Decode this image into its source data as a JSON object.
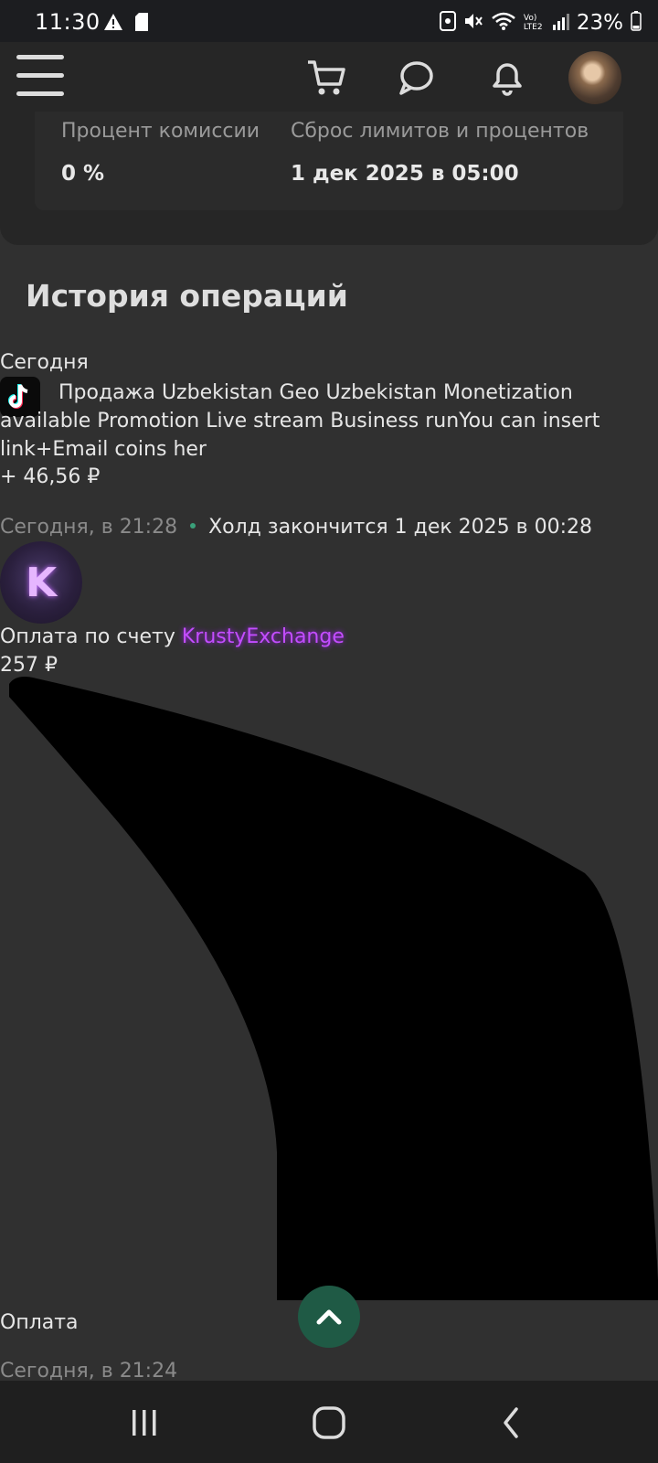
{
  "status_bar": {
    "time": "11:30",
    "battery_percent": "23%",
    "signal_label": "Vo) LTE2",
    "icons": [
      "alert-icon",
      "sd-card-icon",
      "nfc-icon",
      "mute-icon",
      "wifi-icon",
      "signal-icon",
      "battery-icon"
    ]
  },
  "header": {
    "icons": [
      "menu-icon",
      "cart-icon",
      "chat-icon",
      "bell-icon",
      "avatar"
    ]
  },
  "limits": {
    "commission_label": "Процент комиссии",
    "commission_value": "0 %",
    "reset_label": "Сброс лимитов и процентов",
    "reset_value": "1 дек 2025 в 05:00"
  },
  "history": {
    "title": "История операций",
    "ops": [
      {
        "date": "Сегодня",
        "icon": "tiktok-icon",
        "text": "Продажа Uzbekistan Geo Uzbekistan Monetization available Promotion Live stream Business runYou can insert link+Email coins her",
        "amount": "+ 46,56 ₽",
        "time": "Сегодня, в 21:28",
        "hold": "Холд закончится 1 дек 2025 в 00:28"
      },
      {
        "avatar_letter": "K",
        "text": "Оплата по счету",
        "link": "KrustyExchange",
        "amount": "257 ₽"
      },
      {
        "text": "Оплата",
        "time": "Сегодня, в 21:24"
      }
    ]
  },
  "colors": {
    "background": "#303030",
    "accent_green": "#1f5a45",
    "link_purple": "#c34dff"
  }
}
